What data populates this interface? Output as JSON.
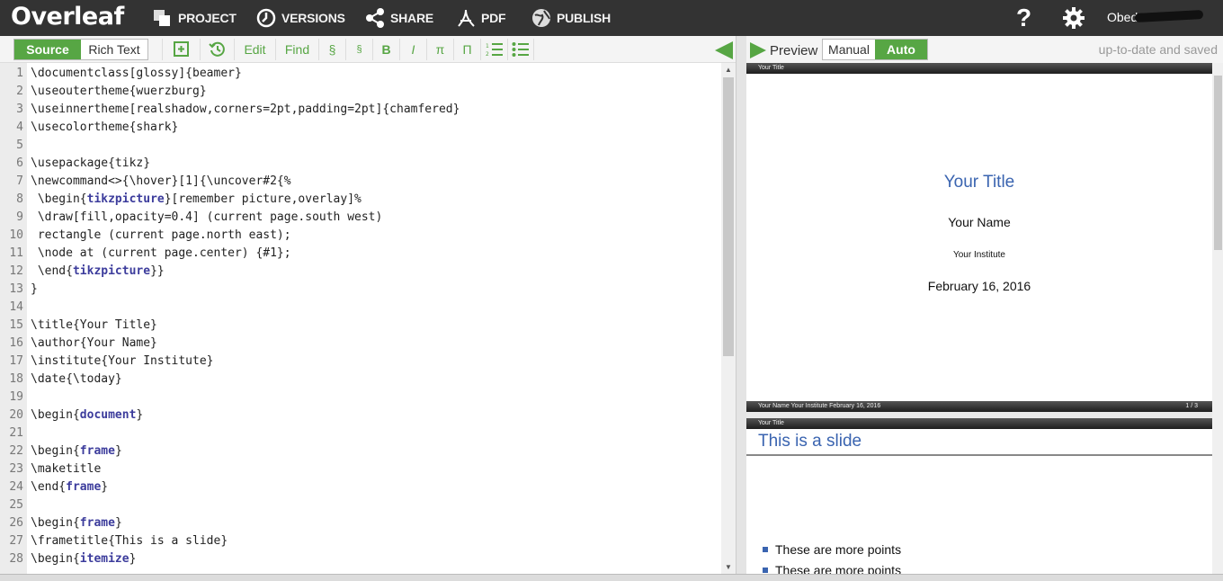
{
  "topbar": {
    "logo": "Overleaf",
    "items": [
      {
        "label": "PROJECT",
        "icon": "project-icon"
      },
      {
        "label": "VERSIONS",
        "icon": "versions-icon"
      },
      {
        "label": "SHARE",
        "icon": "share-icon"
      },
      {
        "label": "PDF",
        "icon": "pdf-icon"
      },
      {
        "label": "PUBLISH",
        "icon": "publish-icon"
      }
    ],
    "help": "?",
    "user": "Obed"
  },
  "editor_toolbar": {
    "tabs": [
      "Source",
      "Rich Text"
    ],
    "edit": "Edit",
    "find": "Find",
    "section": "§",
    "subsection": "§",
    "bold": "B",
    "italic": "I",
    "math": "π",
    "pi_upper": "Π"
  },
  "editor": {
    "lines": [
      {
        "n": "1",
        "text": "\\documentclass[glossy]{beamer}"
      },
      {
        "n": "2",
        "text": "\\useoutertheme{wuerzburg}"
      },
      {
        "n": "3",
        "text": "\\useinnertheme[realshadow,corners=2pt,padding=2pt]{chamfered}"
      },
      {
        "n": "4",
        "text": "\\usecolortheme{shark}"
      },
      {
        "n": "5",
        "text": ""
      },
      {
        "n": "6",
        "text": "\\usepackage{tikz}"
      },
      {
        "n": "7",
        "text": "\\newcommand<>{\\hover}[1]{\\uncover#2{%"
      },
      {
        "n": "8",
        "text": " \\begin{tikzpicture}[remember picture,overlay]%"
      },
      {
        "n": "9",
        "text": " \\draw[fill,opacity=0.4] (current page.south west)"
      },
      {
        "n": "10",
        "text": " rectangle (current page.north east);"
      },
      {
        "n": "11",
        "text": " \\node at (current page.center) {#1};"
      },
      {
        "n": "12",
        "text": " \\end{tikzpicture}}"
      },
      {
        "n": "13",
        "text": "}"
      },
      {
        "n": "14",
        "text": ""
      },
      {
        "n": "15",
        "text": "\\title{Your Title}"
      },
      {
        "n": "16",
        "text": "\\author{Your Name}"
      },
      {
        "n": "17",
        "text": "\\institute{Your Institute}"
      },
      {
        "n": "18",
        "text": "\\date{\\today}"
      },
      {
        "n": "19",
        "text": ""
      },
      {
        "n": "20",
        "text": "\\begin{document}"
      },
      {
        "n": "21",
        "text": ""
      },
      {
        "n": "22",
        "text": "\\begin{frame}"
      },
      {
        "n": "23",
        "text": "\\maketitle"
      },
      {
        "n": "24",
        "text": "\\end{frame}"
      },
      {
        "n": "25",
        "text": ""
      },
      {
        "n": "26",
        "text": "\\begin{frame}"
      },
      {
        "n": "27",
        "text": "\\frametitle{This is a slide}"
      },
      {
        "n": "28",
        "text": "\\begin{itemize}"
      }
    ]
  },
  "preview_toolbar": {
    "preview": "Preview",
    "modes": [
      "Manual",
      "Auto"
    ],
    "status": "up-to-date and saved"
  },
  "preview": {
    "slide1": {
      "header": "Your Title",
      "title": "Your Title",
      "author": "Your Name",
      "institute": "Your Institute",
      "date": "February 16, 2016",
      "footer_left": "Your Name   Your Institute   February 16, 2016",
      "page": "1 / 3"
    },
    "slide2": {
      "header": "Your Title",
      "title": "This is a slide",
      "bullets": [
        "These are more points",
        "These are more points"
      ]
    }
  },
  "colors": {
    "accent": "#57a644",
    "topbar": "#333333",
    "beamer_blue": "#3a64b0"
  }
}
